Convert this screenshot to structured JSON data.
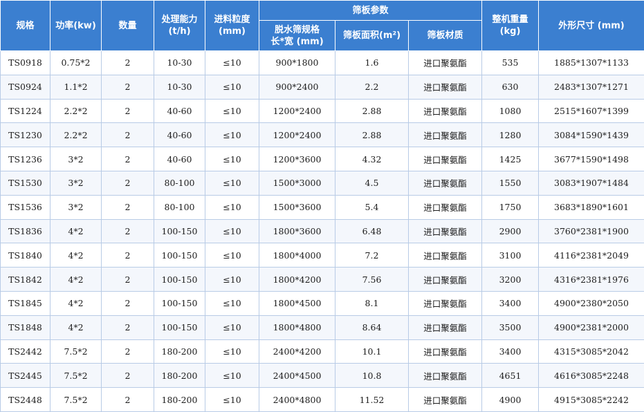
{
  "headers": {
    "spec": "规格",
    "power": "功率(kw)",
    "qty": "数量",
    "capacity": "处理能力\n(t/h)",
    "feed": "进料粒度\n(mm)",
    "screen_group": "筛板参数",
    "dewater": "脱水筛规格\n长*宽 (mm)",
    "area": "筛板面积(m²)",
    "material": "筛板材质",
    "weight": "整机重量\n(kg)",
    "dims": "外形尺寸 (mm)"
  },
  "rows": [
    [
      "TS0918",
      "0.75*2",
      "2",
      "10-30",
      "≤10",
      "900*1800",
      "1.6",
      "进口聚氨酯",
      "535",
      "1885*1307*1133"
    ],
    [
      "TS0924",
      "1.1*2",
      "2",
      "10-30",
      "≤10",
      "900*2400",
      "2.2",
      "进口聚氨酯",
      "630",
      "2483*1307*1271"
    ],
    [
      "TS1224",
      "2.2*2",
      "2",
      "40-60",
      "≤10",
      "1200*2400",
      "2.88",
      "进口聚氨酯",
      "1080",
      "2515*1607*1399"
    ],
    [
      "TS1230",
      "2.2*2",
      "2",
      "40-60",
      "≤10",
      "1200*2400",
      "2.88",
      "进口聚氨酯",
      "1280",
      "3084*1590*1439"
    ],
    [
      "TS1236",
      "3*2",
      "2",
      "40-60",
      "≤10",
      "1200*3600",
      "4.32",
      "进口聚氨酯",
      "1425",
      "3677*1590*1498"
    ],
    [
      "TS1530",
      "3*2",
      "2",
      "80-100",
      "≤10",
      "1500*3000",
      "4.5",
      "进口聚氨酯",
      "1550",
      "3083*1907*1484"
    ],
    [
      "TS1536",
      "3*2",
      "2",
      "80-100",
      "≤10",
      "1500*3600",
      "5.4",
      "进口聚氨酯",
      "1750",
      "3683*1890*1601"
    ],
    [
      "TS1836",
      "4*2",
      "2",
      "100-150",
      "≤10",
      "1800*3600",
      "6.48",
      "进口聚氨酯",
      "2900",
      "3760*2381*1900"
    ],
    [
      "TS1840",
      "4*2",
      "2",
      "100-150",
      "≤10",
      "1800*4000",
      "7.2",
      "进口聚氨酯",
      "3100",
      "4116*2381*2049"
    ],
    [
      "TS1842",
      "4*2",
      "2",
      "100-150",
      "≤10",
      "1800*4200",
      "7.56",
      "进口聚氨酯",
      "3200",
      "4316*2381*1976"
    ],
    [
      "TS1845",
      "4*2",
      "2",
      "100-150",
      "≤10",
      "1800*4500",
      "8.1",
      "进口聚氨酯",
      "3400",
      "4900*2380*2050"
    ],
    [
      "TS1848",
      "4*2",
      "2",
      "100-150",
      "≤10",
      "1800*4800",
      "8.64",
      "进口聚氨酯",
      "3500",
      "4900*2381*2000"
    ],
    [
      "TS2442",
      "7.5*2",
      "2",
      "180-200",
      "≤10",
      "2400*4200",
      "10.1",
      "进口聚氨酯",
      "3400",
      "4315*3085*2042"
    ],
    [
      "TS2445",
      "7.5*2",
      "2",
      "180-200",
      "≤10",
      "2400*4500",
      "10.8",
      "进口聚氨酯",
      "4651",
      "4616*3085*2248"
    ],
    [
      "TS2448",
      "7.5*2",
      "2",
      "180-200",
      "≤10",
      "2400*4800",
      "11.52",
      "进口聚氨酯",
      "4900",
      "4915*3085*2242"
    ]
  ]
}
